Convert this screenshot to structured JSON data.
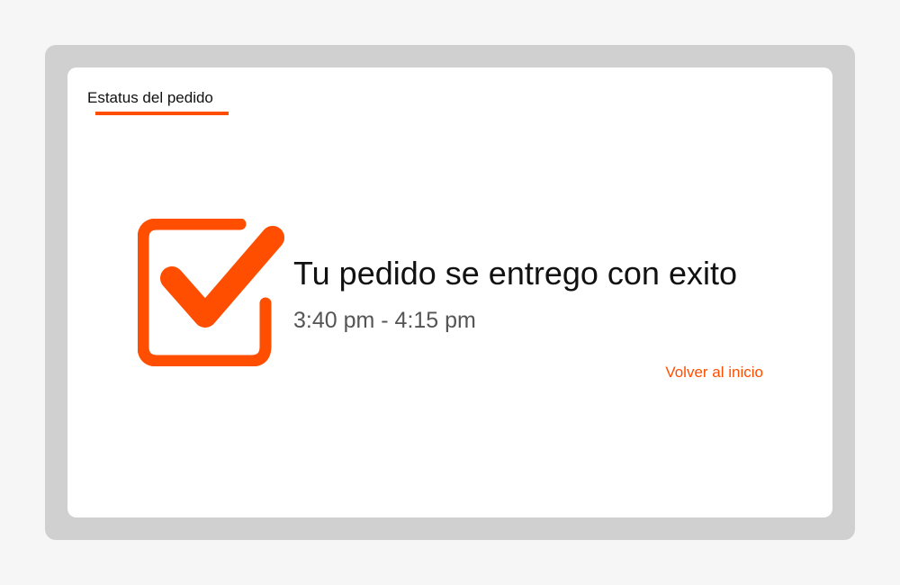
{
  "tab": {
    "label": "Estatus del pedido"
  },
  "status": {
    "title": "Tu pedido se entrego con exito",
    "time_range": "3:40 pm - 4:15 pm",
    "icon": "check-box-icon"
  },
  "actions": {
    "back_label": "Volver al inicio"
  },
  "colors": {
    "accent": "#ff4e00",
    "frame": "#d0d0d0",
    "card": "#ffffff",
    "text": "#111111",
    "muted_text": "#555555"
  }
}
